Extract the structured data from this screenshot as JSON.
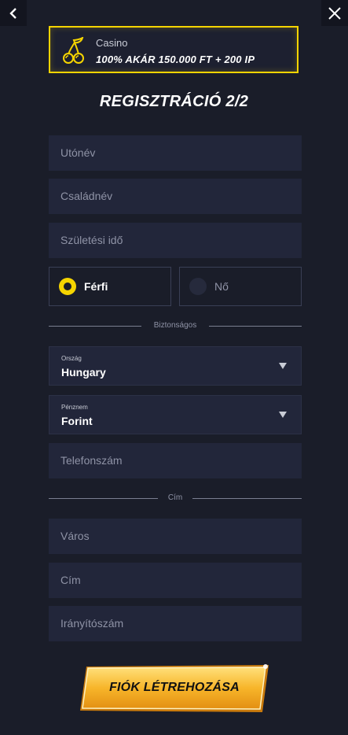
{
  "nav": {
    "back_icon": "chevron-left-icon",
    "close_icon": "close-icon"
  },
  "promo": {
    "icon": "cherry-icon",
    "category": "Casino",
    "offer": "100% AKÁR 150.000 FT + 200 IP"
  },
  "title": "REGISZTRÁCIÓ 2/2",
  "fields": {
    "first_name": {
      "placeholder": "Utónév"
    },
    "last_name": {
      "placeholder": "Családnév"
    },
    "birth_date": {
      "placeholder": "Születési idő"
    }
  },
  "gender": {
    "male": "Férfi",
    "female": "Nő",
    "selected": "male"
  },
  "security_divider": "Biztonságos",
  "country": {
    "label": "Ország",
    "value": "Hungary"
  },
  "currency": {
    "label": "Pénznem",
    "value": "Forint"
  },
  "phone": {
    "placeholder": "Telefonszám"
  },
  "address_divider": "Cím",
  "address": {
    "city": {
      "placeholder": "Város"
    },
    "street": {
      "placeholder": "Cím"
    },
    "zip": {
      "placeholder": "Irányítószám"
    }
  },
  "submit_label": "FIÓK LÉTREHOZÁSA",
  "colors": {
    "accent": "#f5d400",
    "background": "#1a1d29",
    "field": "#22263a"
  }
}
